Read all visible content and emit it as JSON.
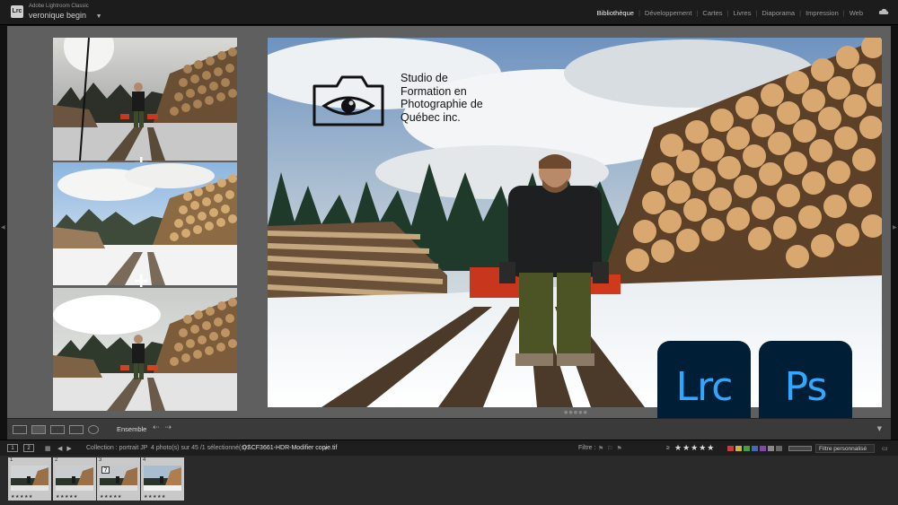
{
  "app": {
    "logo_text": "Lrc",
    "small_title": "Adobe Lightroom Classic",
    "user_name": "veronique begin",
    "caret": "▼"
  },
  "modules": [
    "Bibliothèque",
    "Développement",
    "Cartes",
    "Livres",
    "Diaporama",
    "Impression",
    "Web"
  ],
  "active_module": "Bibliothèque",
  "overlay": {
    "studio_lines": [
      "Studio de",
      "Formation en",
      "Photographie de",
      "Québec inc."
    ],
    "badge_lrc": "Lrc",
    "badge_ps": "Ps"
  },
  "toolbar": {
    "view_mode": "Ensemble"
  },
  "filmstrip_header": {
    "page_left": "1",
    "page_right": "2",
    "collection": "Collection : portrait JP",
    "count": "4 photo(s) sur 45 /1 sélectionné(s) /",
    "filename": "DSCF3661-HDR-Modifier copie.tif",
    "filename_caret": "▾",
    "filter_label": "Filtre :",
    "rating_op": "≥",
    "stars": "★★★★★",
    "filter_preset": "Filtre personnalisé"
  },
  "filmstrip": [
    {
      "num": "1",
      "stars": "★★★★★"
    },
    {
      "num": "2",
      "stars": "★★★★★"
    },
    {
      "num": "3",
      "stars": "★★★★★",
      "badge": "7"
    },
    {
      "num": "4",
      "stars": "★★★★★"
    }
  ],
  "colors": {
    "adobe_badge_bg": "#001e36",
    "adobe_badge_fg": "#31a8ff",
    "label_red": "#c43c3c",
    "label_yellow": "#c8b640",
    "label_green": "#4a9b46",
    "label_blue": "#3d6bb8",
    "label_purple": "#8048a8"
  }
}
